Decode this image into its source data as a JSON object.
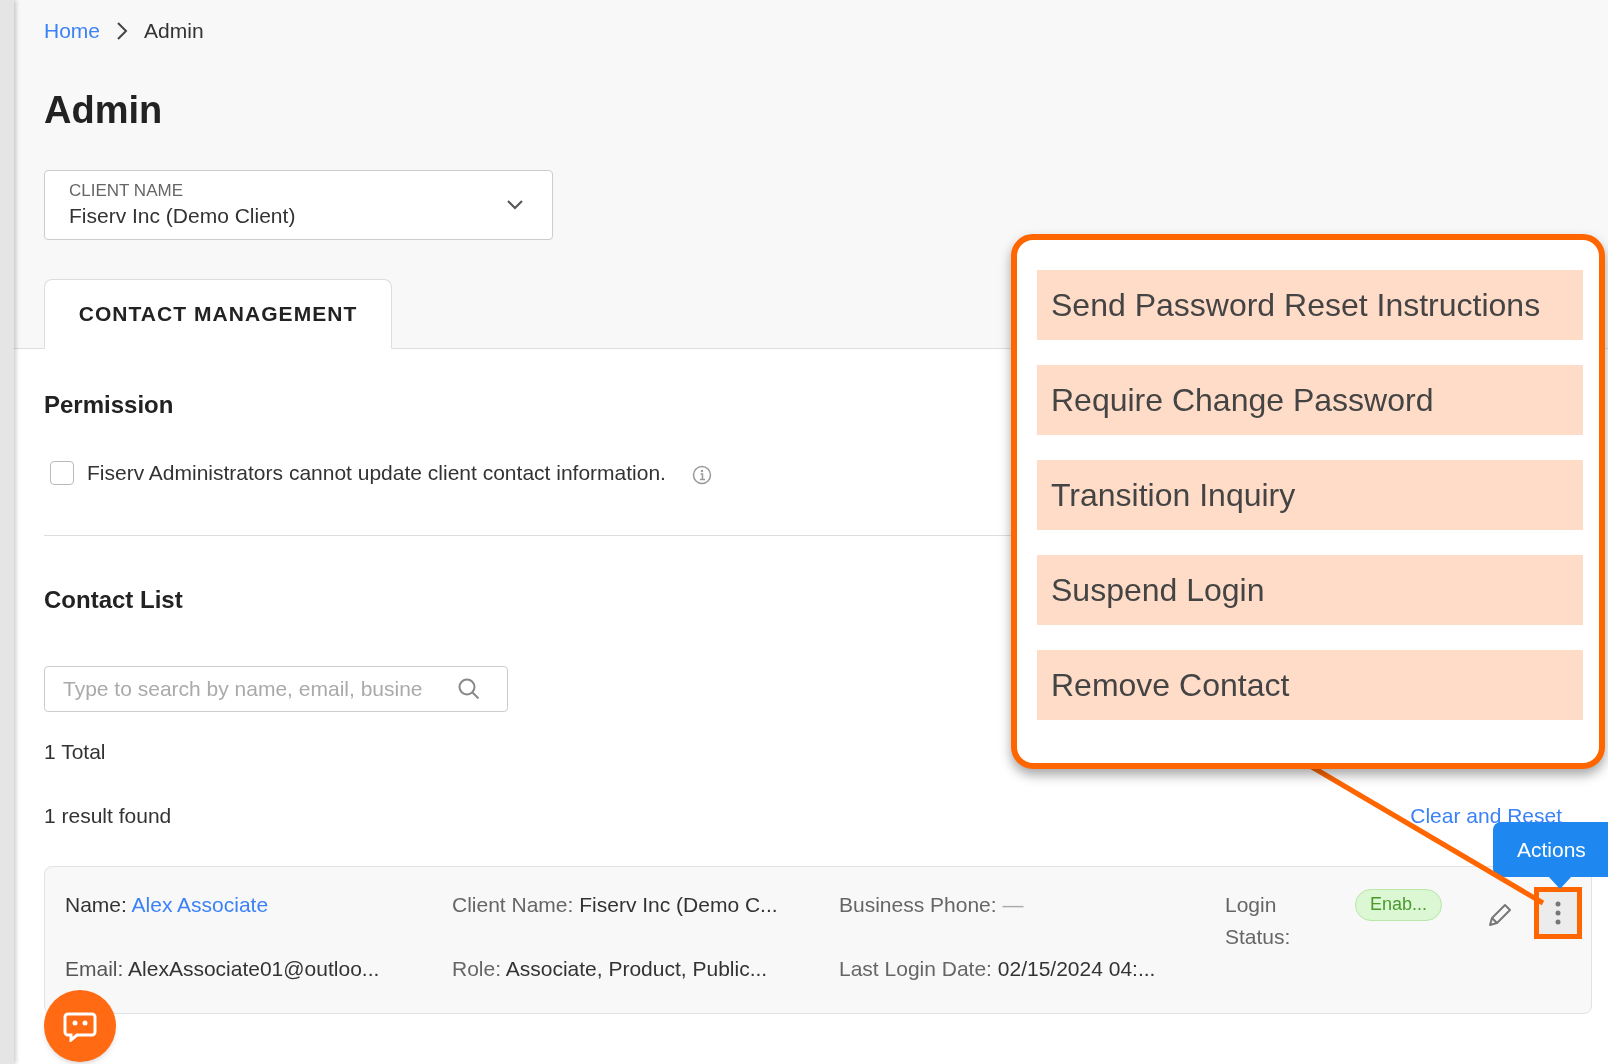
{
  "breadcrumb": [
    {
      "label": "Home",
      "kind": "link"
    },
    {
      "label": "Admin",
      "kind": "current"
    }
  ],
  "title": "Admin",
  "client_select": {
    "label": "CLIENT NAME",
    "value": "Fiserv Inc (Demo Client)"
  },
  "tabs": [
    {
      "label": "CONTACT MANAGEMENT",
      "selected": true
    }
  ],
  "permission": {
    "heading": "Permission",
    "checkbox": {
      "label": "Fiserv Administrators cannot update client contact information.",
      "checked": false
    }
  },
  "contact_list": {
    "heading": "Contact List",
    "search": {
      "placeholder": "Type to search by name, email, busine"
    },
    "total": "1 Total",
    "results": "1 result found",
    "clear_link": "Clear and Reset",
    "contacts": [
      {
        "name_label": "Name:",
        "name": "Alex Associate",
        "client_label": "Client Name:",
        "client": "Fiserv Inc (Demo C...",
        "phone_label": "Business Phone:",
        "phone": "—",
        "status_label": "Login Status:",
        "status": "Enab...",
        "email_label": "Email:",
        "email": "AlexAssociate01@outloo...",
        "role_label": "Role:",
        "role": "Associate, Product, Public...",
        "last_login_label": "Last Login Date:",
        "last_login": "02/15/2024 04:..."
      }
    ]
  },
  "tooltip": "Actions",
  "callout": {
    "items": [
      "Send Password Reset Instructions",
      "Require Change Password",
      "Transition Inquiry",
      "Suspend Login",
      "Remove Contact"
    ]
  }
}
